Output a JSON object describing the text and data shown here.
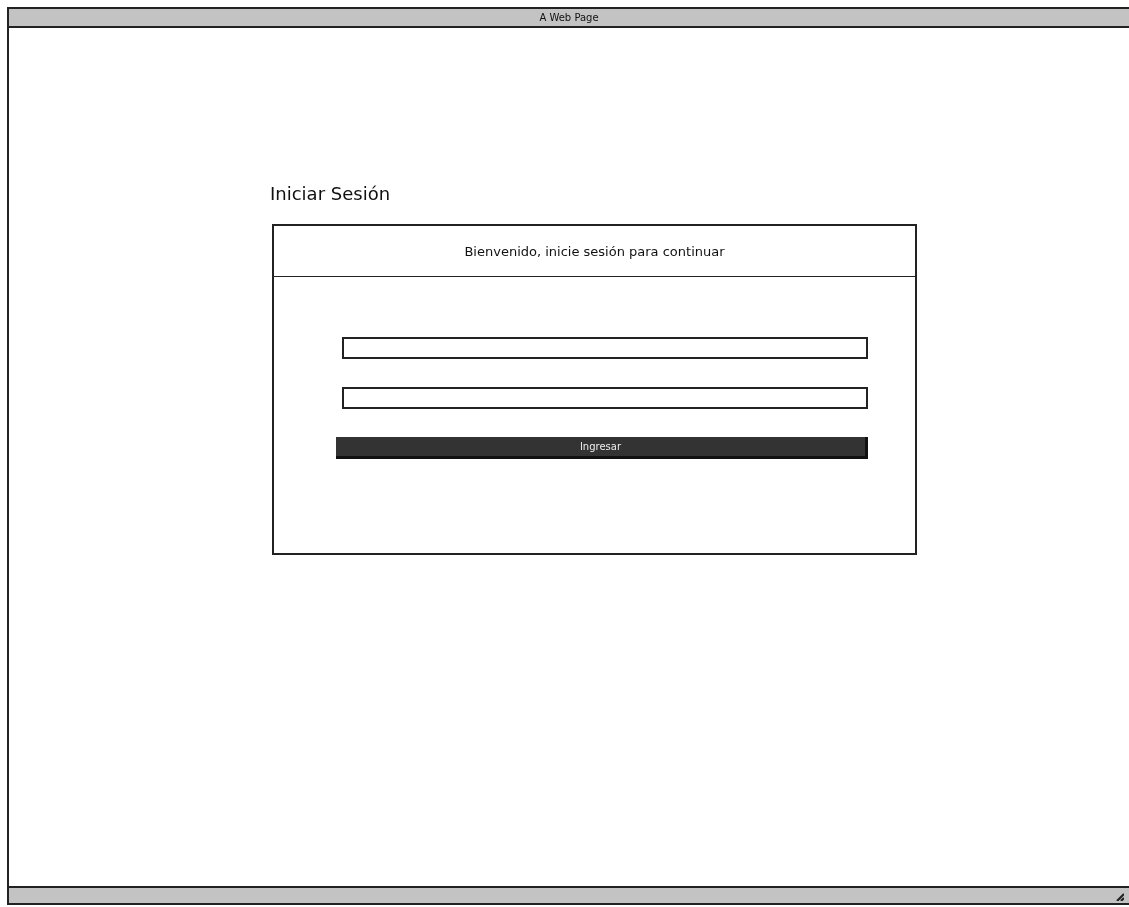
{
  "window": {
    "title": "A Web Page"
  },
  "page": {
    "heading": "Iniciar Sesión"
  },
  "login_card": {
    "header": "Bienvenido, inicie sesión para continuar",
    "button": "Ingresar"
  }
}
